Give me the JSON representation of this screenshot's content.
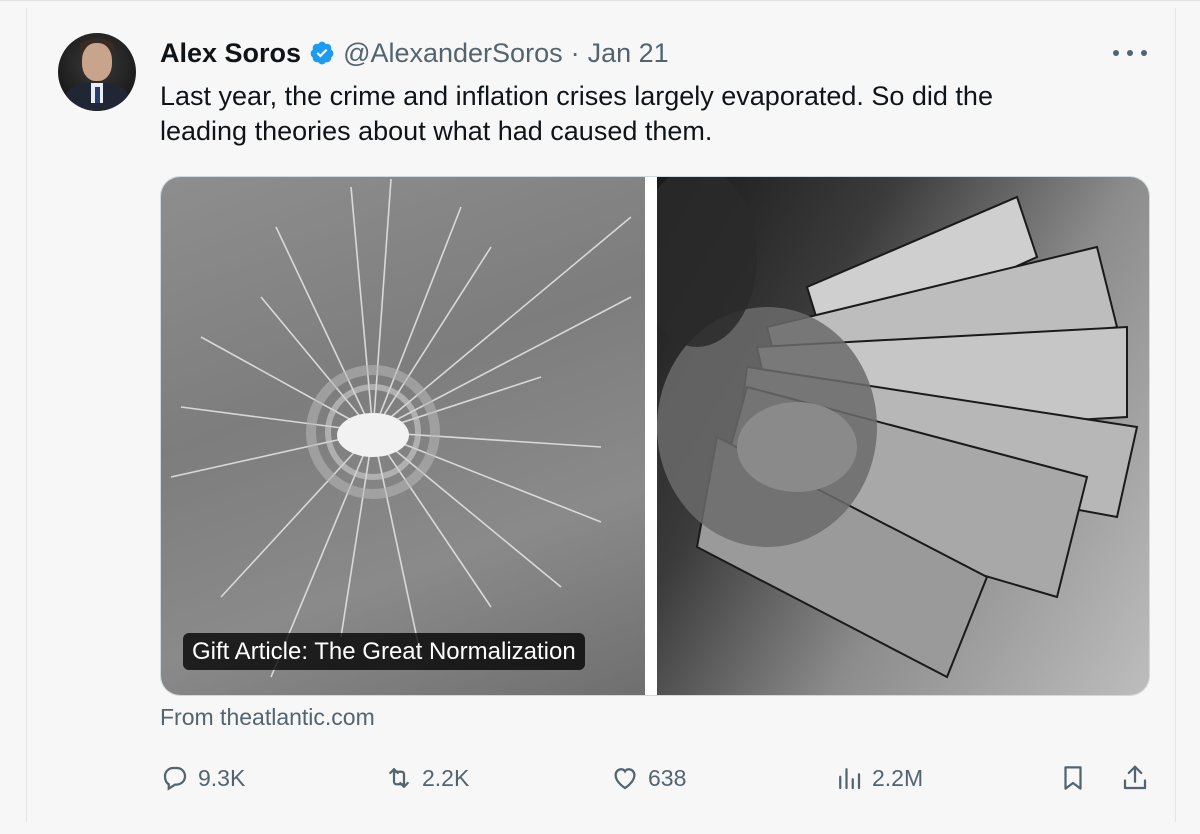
{
  "tweet": {
    "author_name": "Alex Soros",
    "verified_icon": "verified-badge-icon",
    "handle": "@AlexanderSoros",
    "separator": "·",
    "date": "Jan 21",
    "text_line1": "Last year, the crime and inflation crises largely evaporated. So did the",
    "text_line2": "leading theories about what had caused them."
  },
  "card": {
    "caption": "Gift Article: The Great Normalization",
    "source": "From theatlantic.com"
  },
  "actions": {
    "replies": "9.3K",
    "reposts": "2.2K",
    "likes": "638",
    "views": "2.2M"
  },
  "colors": {
    "text": "#0f1419",
    "muted": "#536471",
    "verified": "#1d9bf0",
    "background": "#f7f7f7"
  }
}
